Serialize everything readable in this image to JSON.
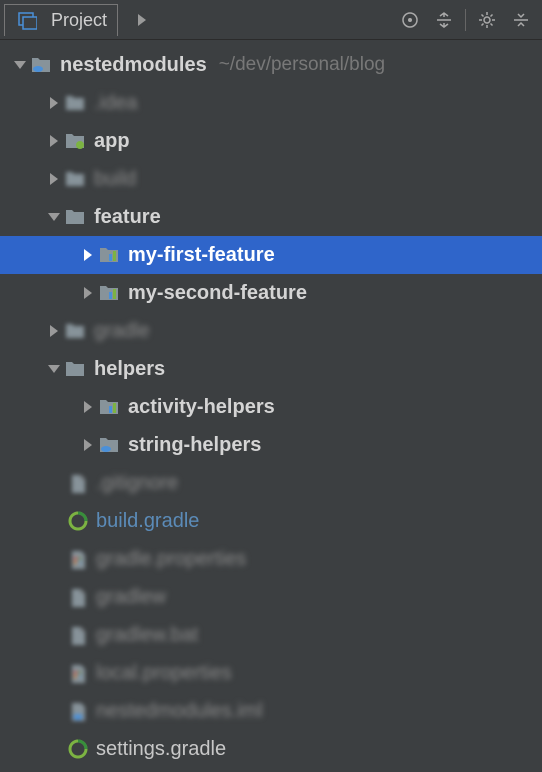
{
  "toolbar": {
    "tab_label": "Project"
  },
  "root": {
    "name": "nestedmodules",
    "path_hint": "~/dev/personal/blog"
  },
  "tree": {
    "idea": ".idea",
    "app": "app",
    "build": "build",
    "feature": "feature",
    "my_first_feature": "my-first-feature",
    "my_second_feature": "my-second-feature",
    "gradle_dir": "gradle",
    "helpers": "helpers",
    "activity_helpers": "activity-helpers",
    "string_helpers": "string-helpers",
    "gitignore": ".gitignore",
    "build_gradle": "build.gradle",
    "gradle_properties": "gradle.properties",
    "gradlew": "gradlew",
    "gradlew_bat": "gradlew.bat",
    "local_properties": "local.properties",
    "nestedmodules_iml": "nestedmodules.iml",
    "settings_gradle": "settings.gradle"
  }
}
